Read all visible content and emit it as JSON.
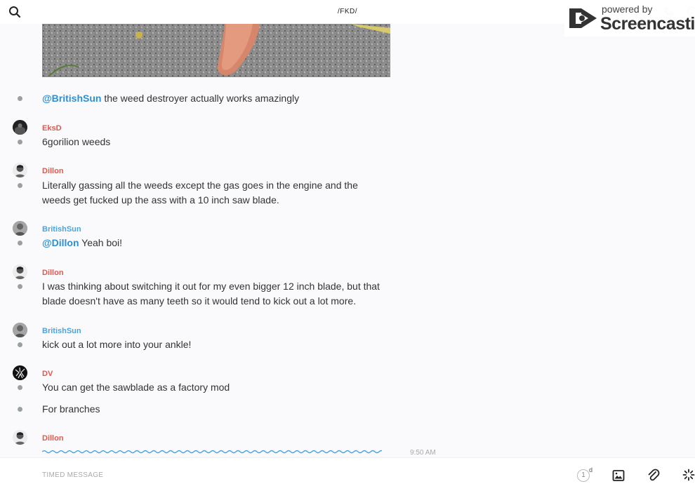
{
  "header": {
    "channel_title": "/FKD/"
  },
  "watermark": {
    "line1": "powered by",
    "line2": "Screencastify"
  },
  "messages": [
    {
      "author": "",
      "mention": "@BritishSun",
      "text": " the weed destroyer actually works amazingly"
    },
    {
      "author": "EksD",
      "mention": "",
      "text": "6gorilion weeds"
    },
    {
      "author": "Dillon",
      "mention": "",
      "text_line1": "Literally gassing all the weeds except the gas goes in the engine and the",
      "text_line2": "weeds get fucked up the ass with a 10 inch saw blade."
    },
    {
      "author": "BritishSun",
      "mention": "@Dillon",
      "text": " Yeah boi!"
    },
    {
      "author": "Dillon",
      "mention": "",
      "text_line1": "I was thinking about switching it out for my even bigger 12 inch blade, but that",
      "text_line2": "blade doesn't have as many teeth so it would tend to kick out a lot more."
    },
    {
      "author": "BritishSun",
      "mention": "",
      "text": "kick out a lot more into your ankle!"
    },
    {
      "author": "DV",
      "mention": "",
      "text": "You can get the sawblade as a factory mod"
    },
    {
      "author": "",
      "mention": "",
      "text": "For branches"
    },
    {
      "author": "Dillon",
      "mention": "",
      "text": ""
    }
  ],
  "last_timestamp": "9:50 AM",
  "composer": {
    "placeholder": "TIMED MESSAGE",
    "timer_value": "1",
    "timer_unit": "d"
  },
  "icons": {
    "search": "search-icon",
    "phone": "phone-icon",
    "info": "info-icon",
    "image": "image-icon",
    "attach": "paperclip-icon",
    "more": "loading-spinner-icon"
  },
  "colors": {
    "author_red": "#e2574c",
    "author_blue": "#4aa3df",
    "mention": "#2d8fd5",
    "background": "#fafafc"
  }
}
